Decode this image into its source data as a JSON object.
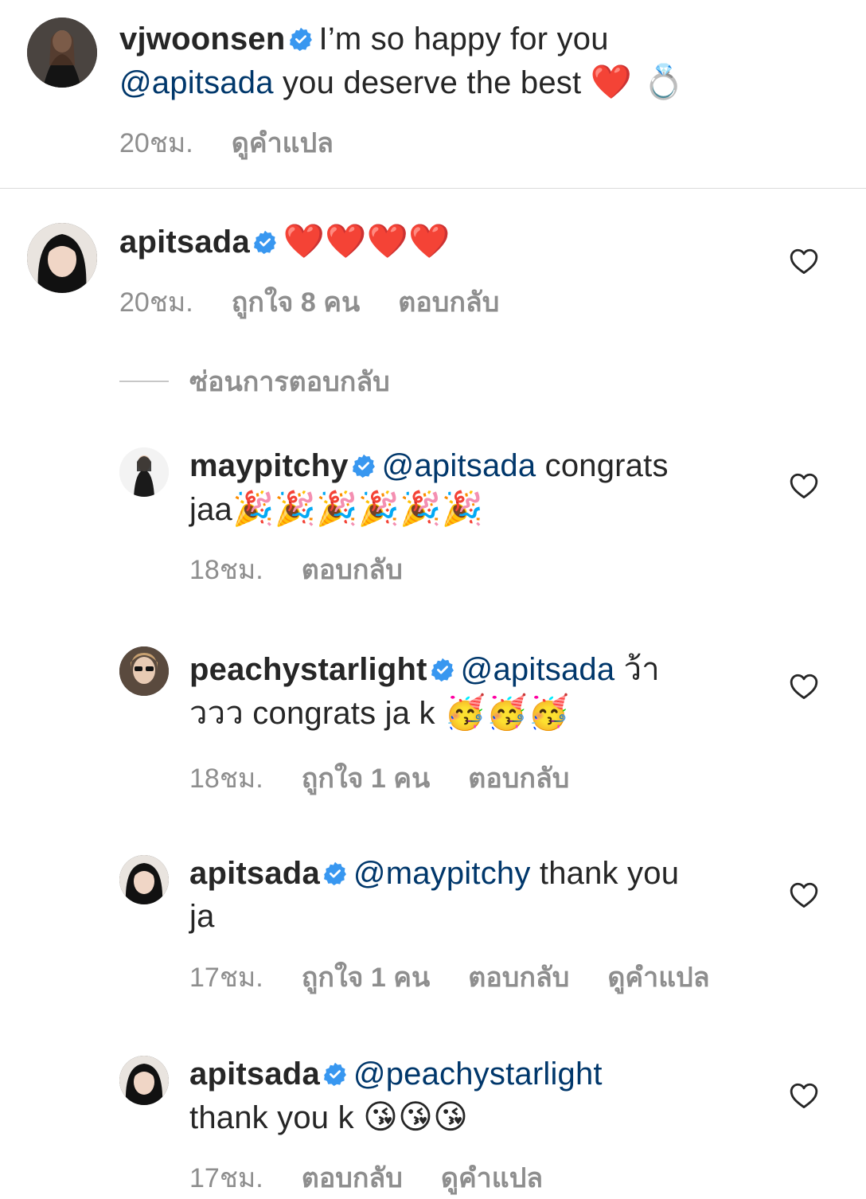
{
  "comments": [
    {
      "username": "vjwoonsen",
      "verified": true,
      "text_before": "I’m so happy for you",
      "mention": "@apitsada",
      "text_after": "you deserve the best",
      "emojis": "❤️ 💍",
      "time": "20ชม.",
      "translate": "ดูคำแปล"
    },
    {
      "username": "apitsada",
      "verified": true,
      "emojis": "❤️❤️❤️❤️",
      "time": "20ชม.",
      "likes": "ถูกใจ 8 คน",
      "reply": "ตอบกลับ"
    }
  ],
  "hide_replies_label": "ซ่อนการตอบกลับ",
  "replies": [
    {
      "username": "maypitchy",
      "verified": true,
      "mention": "@apitsada",
      "text_line1": "congrats",
      "text_line2": "jaa",
      "emojis": "🎉🎉🎉🎉🎉🎉",
      "time": "18ชม.",
      "reply": "ตอบกลับ"
    },
    {
      "username": "peachystarlight",
      "verified": true,
      "mention": "@apitsada",
      "text_line1": "ว้า",
      "text_line2": "ววว congrats ja k",
      "emojis": "🥳🥳🥳",
      "time": "18ชม.",
      "likes": "ถูกใจ 1 คน",
      "reply": "ตอบกลับ"
    },
    {
      "username": "apitsada",
      "verified": true,
      "mention": "@maypitchy",
      "text_line1": "thank you",
      "text_line2": "ja",
      "time": "17ชม.",
      "likes": "ถูกใจ 1 คน",
      "reply": "ตอบกลับ",
      "translate": "ดูคำแปล"
    },
    {
      "username": "apitsada",
      "verified": true,
      "mention": "@peachystarlight",
      "text_line2": "thank you k",
      "emojis": "😘😘😘",
      "time": "17ชม.",
      "reply": "ตอบกลับ",
      "translate": "ดูคำแปล"
    }
  ],
  "colors": {
    "text": "#262626",
    "mention": "#00376b",
    "meta": "#8e8e8e",
    "verified": "#3897f0",
    "divider": "#dbdbdb"
  },
  "icons": {
    "verified": "verified-badge-icon",
    "like": "heart-outline-icon"
  }
}
